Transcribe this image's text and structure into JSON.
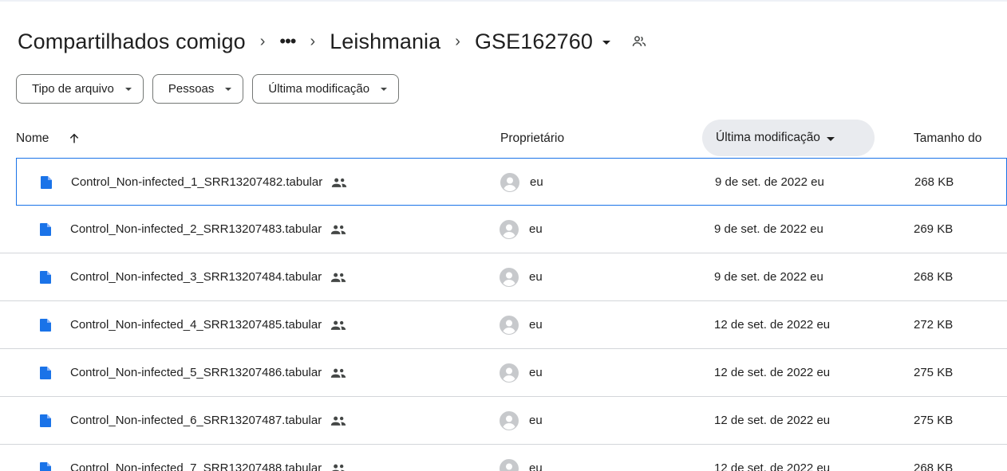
{
  "breadcrumb": {
    "root": "Compartilhados comigo",
    "more": "•••",
    "parent": "Leishmania",
    "current": "GSE162760"
  },
  "filters": [
    {
      "label": "Tipo de arquivo"
    },
    {
      "label": "Pessoas"
    },
    {
      "label": "Última modificação"
    }
  ],
  "table": {
    "headers": {
      "name": "Nome",
      "owner": "Proprietário",
      "modified": "Última modificação",
      "size": "Tamanho do"
    },
    "rows": [
      {
        "name": "Control_Non-infected_1_SRR13207482.tabular",
        "owner": "eu",
        "modified": "9 de set. de 2022 eu",
        "size": "268 KB"
      },
      {
        "name": "Control_Non-infected_2_SRR13207483.tabular",
        "owner": "eu",
        "modified": "9 de set. de 2022 eu",
        "size": "269 KB"
      },
      {
        "name": "Control_Non-infected_3_SRR13207484.tabular",
        "owner": "eu",
        "modified": "9 de set. de 2022 eu",
        "size": "268 KB"
      },
      {
        "name": "Control_Non-infected_4_SRR13207485.tabular",
        "owner": "eu",
        "modified": "12 de set. de 2022 eu",
        "size": "272 KB"
      },
      {
        "name": "Control_Non-infected_5_SRR13207486.tabular",
        "owner": "eu",
        "modified": "12 de set. de 2022 eu",
        "size": "275 KB"
      },
      {
        "name": "Control_Non-infected_6_SRR13207487.tabular",
        "owner": "eu",
        "modified": "12 de set. de 2022 eu",
        "size": "275 KB"
      },
      {
        "name": "Control_Non-infected_7_SRR13207488.tabular",
        "owner": "eu",
        "modified": "12 de set. de 2022 eu",
        "size": "268 KB"
      }
    ]
  },
  "colors": {
    "accent": "#1a73e8",
    "file_icon": "#1a73e8",
    "selected_header_bg": "#e9ebef"
  }
}
